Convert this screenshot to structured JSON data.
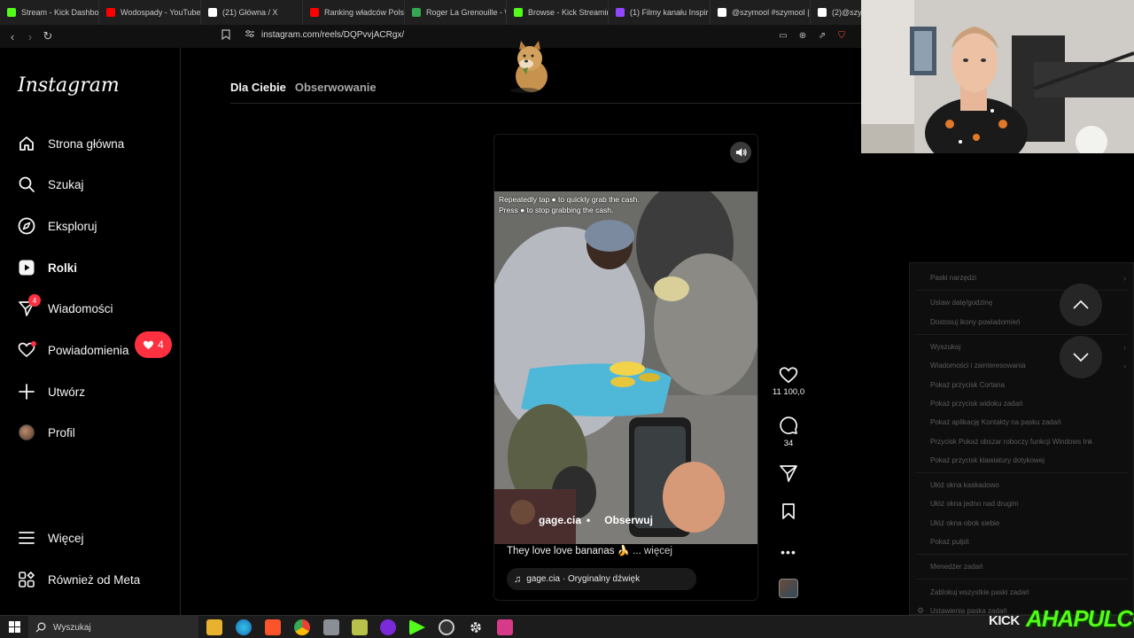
{
  "browser": {
    "tabs": [
      {
        "label": "Stream - Kick Dashbo",
        "icon": "kick-icon",
        "color": "#53fc18"
      },
      {
        "label": "Wodospady - YouTube",
        "icon": "youtube-icon",
        "color": "#ff0000"
      },
      {
        "label": "(21) Główna / X",
        "icon": "x-icon",
        "color": "#ffffff"
      },
      {
        "label": "Ranking władców Polsk",
        "icon": "youtube-icon",
        "color": "#ff0000"
      },
      {
        "label": "Roger La Grenouille - \\",
        "icon": "maps-pin-icon",
        "color": "#34a853"
      },
      {
        "label": "Browse - Kick Streamin",
        "icon": "kick-icon",
        "color": "#53fc18"
      },
      {
        "label": "(1) Filmy kanału Inspir",
        "icon": "twitch-icon",
        "color": "#9146ff"
      },
      {
        "label": "@szymool #szymool |",
        "icon": "tiktok-icon",
        "color": "#ffffff"
      },
      {
        "label": "(2)@szym",
        "icon": "tiktok-icon",
        "color": "#ffffff"
      }
    ],
    "url": "instagram.com/reels/DQPvvjACRgx/"
  },
  "sidebar": {
    "logo": "Instagram",
    "items": [
      {
        "label": "Strona główna",
        "icon": "home-icon"
      },
      {
        "label": "Szukaj",
        "icon": "search-icon"
      },
      {
        "label": "Eksploruj",
        "icon": "compass-icon"
      },
      {
        "label": "Rolki",
        "icon": "reels-icon"
      },
      {
        "label": "Wiadomości",
        "icon": "messenger-icon",
        "badge": "4"
      },
      {
        "label": "Powiadomienia",
        "icon": "heart-icon"
      },
      {
        "label": "Utwórz",
        "icon": "plus-icon"
      },
      {
        "label": "Profil",
        "icon": "avatar"
      }
    ],
    "notification_pill": "4",
    "bottom": [
      {
        "label": "Więcej",
        "icon": "hamburger-icon"
      },
      {
        "label": "Również od Meta",
        "icon": "meta-grid-icon"
      }
    ]
  },
  "feed": {
    "tabs": [
      "Dla Ciebie",
      "Obserwowanie"
    ]
  },
  "reel": {
    "video_caption": "Repeatedly tap ● to quickly grab the cash. Press ● to stop grabbing the cash.",
    "username": "gage.cia",
    "follow": "Obserwuj",
    "caption": "They love love bananas 🍌",
    "more": "... więcej",
    "audio": "gage.cia · Oryginalny dźwięk",
    "likes": "11 100,0",
    "comments": "34"
  },
  "context_menu": {
    "items": [
      {
        "label": "Paski narzędzi",
        "submenu": true
      },
      {
        "sep": true
      },
      {
        "label": "Ustaw datę/godzinę"
      },
      {
        "label": "Dostosuj ikony powiadomień"
      },
      {
        "sep": true
      },
      {
        "label": "Wyszukaj",
        "submenu": true
      },
      {
        "label": "Wiadomości i zainteresowania",
        "submenu": true
      },
      {
        "label": "Pokaż przycisk Cortana"
      },
      {
        "label": "Pokaż przycisk widoku zadań"
      },
      {
        "label": "Pokaż aplikację Kontakty na pasku zadań"
      },
      {
        "label": "Przycisk Pokaż obszar roboczy funkcji Windows Ink"
      },
      {
        "label": "Pokaż przycisk klawiatury dotykowej"
      },
      {
        "sep": true
      },
      {
        "label": "Ułóż okna kaskadowo"
      },
      {
        "label": "Ułóż okna jedno nad drugim"
      },
      {
        "label": "Ułóż okna obok siebie"
      },
      {
        "label": "Pokaż pulpit"
      },
      {
        "sep": true
      },
      {
        "label": "Menedżer zadań"
      },
      {
        "sep": true
      },
      {
        "label": "Zablokuj wszystkie paski zadań"
      },
      {
        "label": "Ustawienia paska zadań",
        "gear": true
      }
    ]
  },
  "taskbar": {
    "search_placeholder": "Wyszukaj"
  },
  "overlay": {
    "kick_logo": "KICK",
    "streamer": "AHAPULCO"
  }
}
